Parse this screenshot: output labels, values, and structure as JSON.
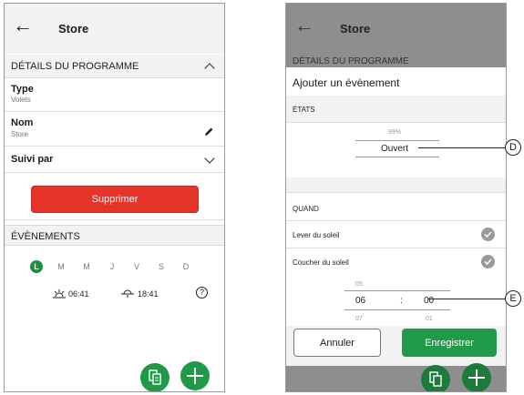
{
  "left": {
    "header": {
      "back_icon": "arrow-left-icon",
      "title": "Store"
    },
    "details_section": "DÉTAILS DU PROGRAMME",
    "type": {
      "label": "Type",
      "value": "Volets"
    },
    "name": {
      "label": "Nom",
      "value": "Store",
      "edit_icon": "pencil-icon"
    },
    "followed_by": {
      "label": "Suivi par"
    },
    "delete_button": "Supprimer",
    "events_section": "ÉVÈNEMENTS",
    "days": [
      "L",
      "M",
      "M",
      "J",
      "V",
      "S",
      "D"
    ],
    "active_day_index": 0,
    "sunrise_time": "06:41",
    "sunset_time": "18:41",
    "help_icon": "question-circle-icon",
    "fab_copy_icon": "copy-icon",
    "fab_add_icon": "plus-icon"
  },
  "right": {
    "header": {
      "title": "Store"
    },
    "details_section_partial": "DÉTAILS DU PROGRAMME",
    "modal": {
      "title": "Ajouter un évènement",
      "states_label": "ÉTATS",
      "state_percent": "99%",
      "state_value": "Ouvert",
      "when_label": "QUAND",
      "options": [
        {
          "label": "Lever du soleil"
        },
        {
          "label": "Coucher du soleil"
        }
      ],
      "time_picker": {
        "hour_prev": "05",
        "hour": "06",
        "hour_next": "07",
        "separator": ":",
        "minute": "00",
        "minute_next": "01"
      },
      "cancel_button": "Annuler",
      "save_button": "Enregistrer"
    },
    "callouts": {
      "d": "D",
      "e": "E"
    }
  },
  "colors": {
    "green": "#1f9a48",
    "red": "#e5342a",
    "overlay": "#8e8e8e"
  }
}
